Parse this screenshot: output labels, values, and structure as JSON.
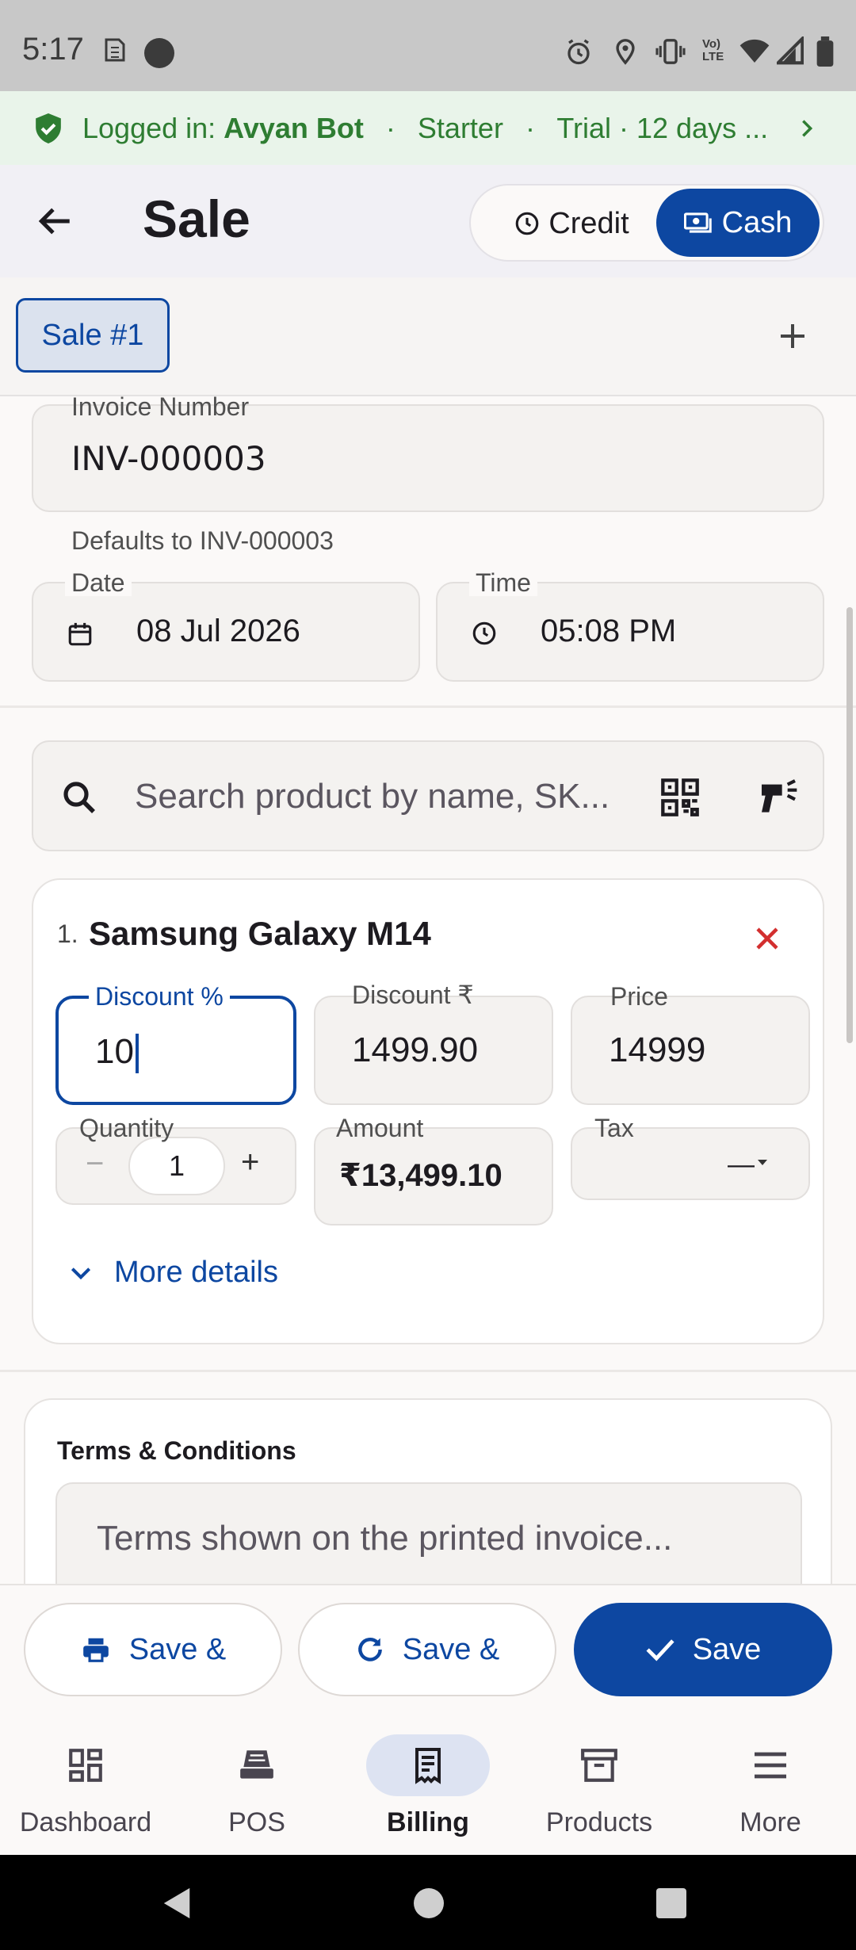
{
  "status_bar": {
    "time": "5:17"
  },
  "banner": {
    "prefix": "Logged in:",
    "user": "Avyan Bot",
    "plan": "Starter",
    "trial": "Trial · 12 days ..."
  },
  "appbar": {
    "title": "Sale",
    "credit_label": "Credit",
    "cash_label": "Cash"
  },
  "tabs": {
    "active": "Sale #1"
  },
  "invoice": {
    "label": "Invoice Number",
    "value": "INV-000003",
    "helper": "Defaults to INV-000003"
  },
  "date": {
    "label": "Date",
    "value": "08 Jul 2026"
  },
  "time": {
    "label": "Time",
    "value": "05:08 PM"
  },
  "search": {
    "placeholder": "Search product by name, SK..."
  },
  "item": {
    "index": "1.",
    "name": "Samsung Galaxy M14",
    "discount_pct_label": "Discount %",
    "discount_pct_value": "10",
    "discount_amt_label": "Discount ₹",
    "discount_amt_value": "1499.90",
    "price_label": "Price",
    "price_value": "14999",
    "quantity_label": "Quantity",
    "quantity_value": "1",
    "amount_label": "Amount",
    "amount_value": "₹13,499.10",
    "tax_label": "Tax",
    "tax_value": "—",
    "more_details": "More details"
  },
  "terms": {
    "title": "Terms & Conditions",
    "placeholder": "Terms shown on the printed invoice..."
  },
  "actions": {
    "save_print": "Save &",
    "save_new": "Save &",
    "save": "Save"
  },
  "nav": {
    "items": [
      "Dashboard",
      "POS",
      "Billing",
      "Products",
      "More"
    ],
    "active": "Billing"
  },
  "colors": {
    "primary": "#0d47a1",
    "success": "#2e7d32",
    "danger": "#d32f2f"
  }
}
